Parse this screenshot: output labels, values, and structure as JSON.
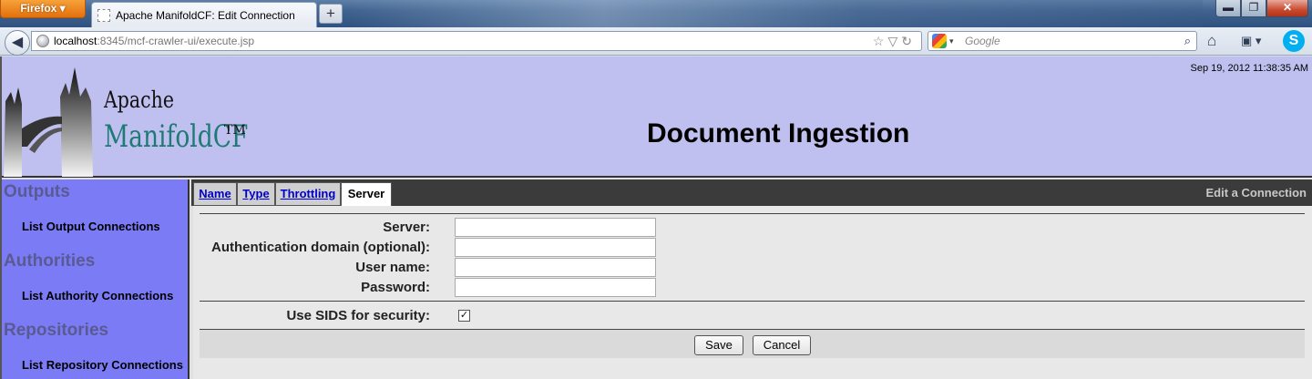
{
  "browser": {
    "menu_button": "Firefox",
    "tab_title": "Apache ManifoldCF: Edit Connection",
    "new_tab": "+",
    "url_host": "localhost",
    "url_rest": ":8345/mcf-crawler-ui/execute.jsp",
    "search_placeholder": "Google",
    "window_controls": {
      "minimize": "▬",
      "maximize": "❐",
      "close": "✕"
    }
  },
  "header": {
    "logo_line1": "Apache",
    "logo_line2": "ManifoldCF",
    "logo_tm": "TM",
    "datetime": "Sep 19, 2012 11:38:35 AM",
    "page_title": "Document Ingestion"
  },
  "sidebar": {
    "sections": [
      {
        "title": "Outputs",
        "link": "List Output Connections"
      },
      {
        "title": "Authorities",
        "link": "List Authority Connections"
      },
      {
        "title": "Repositories",
        "link": "List Repository Connections"
      }
    ]
  },
  "tabs": [
    {
      "label": "Name",
      "active": false
    },
    {
      "label": "Type",
      "active": false
    },
    {
      "label": "Throttling",
      "active": false
    },
    {
      "label": "Server",
      "active": true
    }
  ],
  "edit_label": "Edit a Connection",
  "form": {
    "fields": [
      {
        "label": "Server:",
        "value": ""
      },
      {
        "label": "Authentication domain (optional):",
        "value": ""
      },
      {
        "label": "User name:",
        "value": ""
      },
      {
        "label": "Password:",
        "value": ""
      }
    ],
    "checkbox_label": "Use SIDS for security:",
    "checkbox_checked": true,
    "checkbox_mark": "✓",
    "save_button": "Save",
    "cancel_button": "Cancel"
  },
  "colors": {
    "banner": "#c0c0f0",
    "sidebar": "#7b7bf5",
    "logo_teal": "#1e7a74",
    "tab_link": "#0000cc"
  }
}
